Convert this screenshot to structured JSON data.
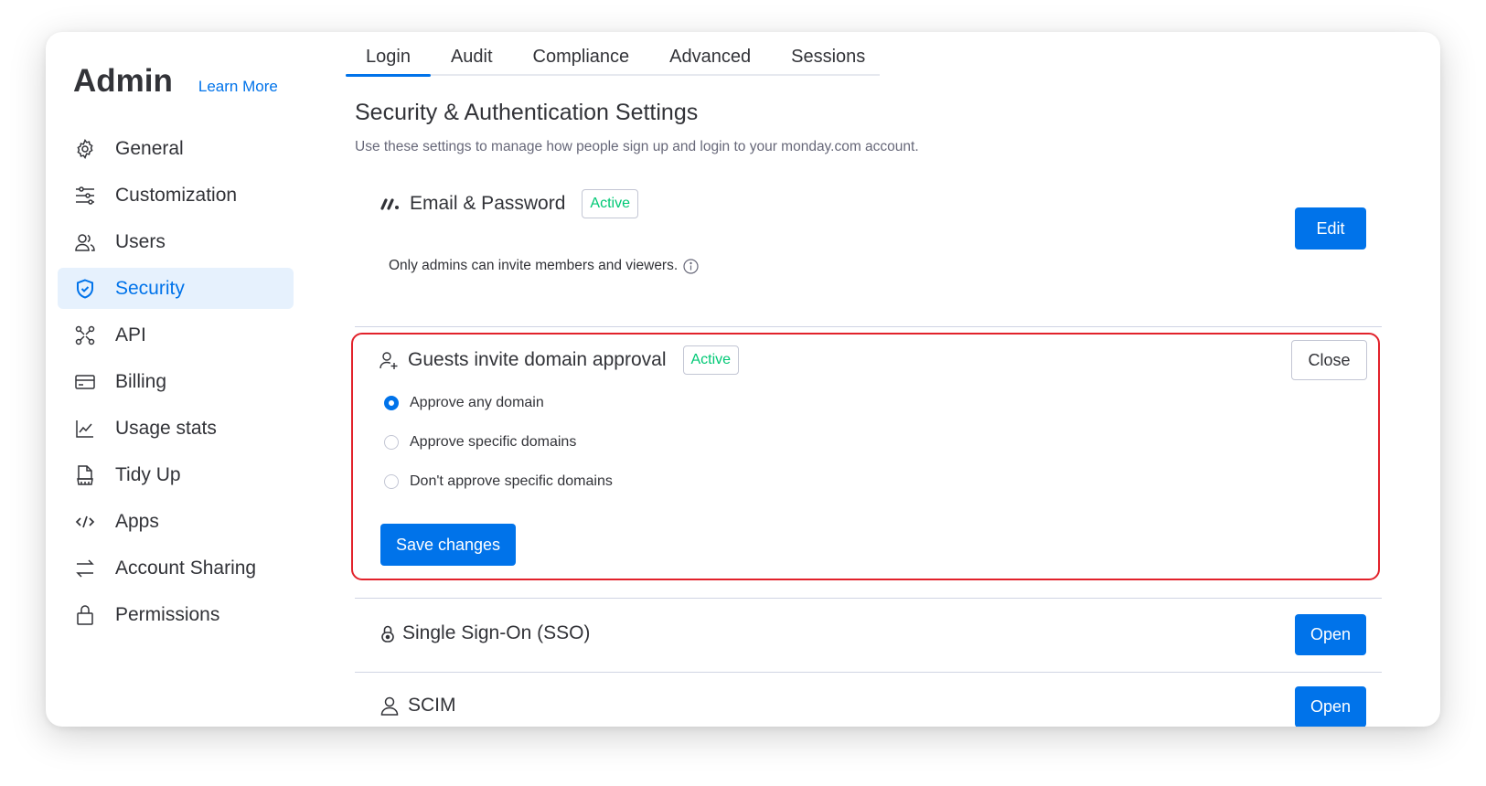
{
  "sidebar": {
    "title": "Admin",
    "learn_more": "Learn More",
    "items": [
      {
        "label": "General",
        "icon": "gear-icon"
      },
      {
        "label": "Customization",
        "icon": "sliders-icon"
      },
      {
        "label": "Users",
        "icon": "users-icon"
      },
      {
        "label": "Security",
        "icon": "shield-icon",
        "active": true
      },
      {
        "label": "API",
        "icon": "api-icon"
      },
      {
        "label": "Billing",
        "icon": "credit-card-icon"
      },
      {
        "label": "Usage stats",
        "icon": "chart-icon"
      },
      {
        "label": "Tidy Up",
        "icon": "tidy-icon"
      },
      {
        "label": "Apps",
        "icon": "code-icon"
      },
      {
        "label": "Account Sharing",
        "icon": "arrows-icon"
      },
      {
        "label": "Permissions",
        "icon": "lock-icon"
      }
    ]
  },
  "tabs": [
    "Login",
    "Audit",
    "Compliance",
    "Advanced",
    "Sessions"
  ],
  "active_tab": "Login",
  "main": {
    "title": "Security & Authentication Settings",
    "subtitle": "Use these settings to manage how people sign up and login to your monday.com account.",
    "email": {
      "title": "Email & Password",
      "badge": "Active",
      "hint": "Only admins can invite members and viewers.",
      "button": "Edit"
    },
    "guests": {
      "title": "Guests invite domain approval",
      "badge": "Active",
      "close": "Close",
      "options": [
        "Approve any domain",
        "Approve specific domains",
        "Don't approve specific domains"
      ],
      "selected": "Approve any domain",
      "save": "Save changes"
    },
    "sso": {
      "title": "Single Sign-On (SSO)",
      "button": "Open"
    },
    "scim": {
      "title": "SCIM",
      "button": "Open"
    }
  },
  "colors": {
    "accent": "#0073ea",
    "active_badge": "#00c875",
    "highlight_border": "#e2222b",
    "active_nav_bg": "#e6f1fd"
  }
}
